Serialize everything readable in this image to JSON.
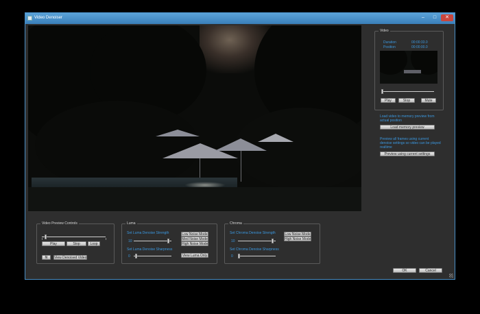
{
  "window": {
    "title": "Video Denoiser",
    "minimize": "–",
    "maximize": "□",
    "close": "✕"
  },
  "video_panel": {
    "group_label": "Video",
    "duration_label": "Duration",
    "duration_value": "00:00:33.0",
    "position_label": "Position",
    "position_value": "00:00:00.0",
    "play": "Play",
    "stop": "Stop",
    "mute": "Mute",
    "slider_value": 0.0
  },
  "memory": {
    "text1": "Load video to memory preview from",
    "text2": "actual position",
    "load_button": "Load memory preview",
    "text3": "Preview all frames using current",
    "text4": "denoise settings so video can be played",
    "text5": "realtime",
    "preview_button": "Preview using current settings"
  },
  "preview_controls": {
    "group_label": "Video Preview Controls",
    "play": "Play",
    "stop": "Stop",
    "loop": "Loop",
    "fit": "fit",
    "view_denoised": "View Denoised Video",
    "slider_value": 0.05
  },
  "luma": {
    "group_label": "Luma",
    "strength_label": "Set Luma Denoise Strength",
    "strength_value": "10",
    "low": "Low Noise Mode",
    "med": "Med Noise Mode",
    "high": "High Noise Mode",
    "sharpness_label": "Set Luma Denoise Sharpness",
    "sharpness_value": "0",
    "view_luma": "View Luma Only",
    "strength_fraction": 0.9,
    "sharpness_fraction": 0.05
  },
  "chroma": {
    "group_label": "Chroma",
    "strength_label": "Set Chroma Denoise Strength",
    "strength_value": "10",
    "low": "Low Noise Mode",
    "high": "High Noise Mode",
    "sharpness_label": "Set Chroma Denoise Sharpness",
    "sharpness_value": "0",
    "strength_fraction": 0.9,
    "sharpness_fraction": 0.02
  },
  "footer": {
    "ok": "OK",
    "cancel": "Cancel"
  }
}
